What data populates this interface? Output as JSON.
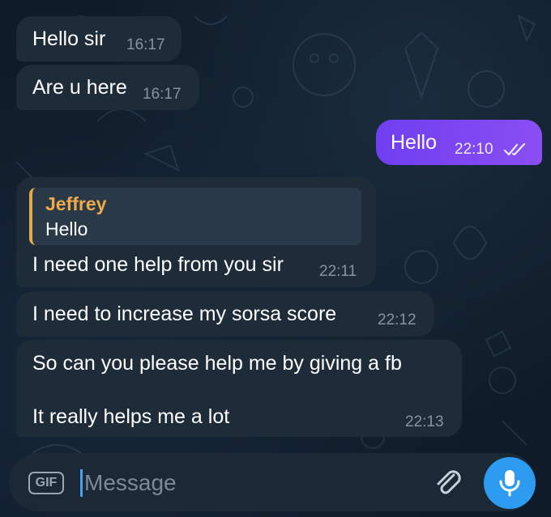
{
  "messages": [
    {
      "text": "Hello sir",
      "time": "16:17"
    },
    {
      "text": "Are u here",
      "time": "16:17"
    },
    {
      "text": "Hello",
      "time": "22:10",
      "status": "read-double-check-icon"
    },
    {
      "reply_to": {
        "name": "Jeffrey",
        "text": "Hello"
      },
      "text": "I need one help from you sir",
      "time": "22:11"
    },
    {
      "text": "I need to increase my sorsa score",
      "time": "22:12"
    },
    {
      "text_line1": "So can you please help me by giving a fb",
      "text_line2": "It really helps me a lot",
      "time": "22:13"
    }
  ],
  "composer": {
    "gif_label": "GIF",
    "placeholder": "Message",
    "attach_icon": "paperclip-icon",
    "mic_icon": "microphone-icon"
  },
  "colors": {
    "background": "#0f1b28",
    "incoming_bubble": "#1e2c3a",
    "outgoing_bubble": "#7c3aed",
    "quote_accent": "#f0aa4a",
    "mic_button": "#2d9cf0"
  }
}
